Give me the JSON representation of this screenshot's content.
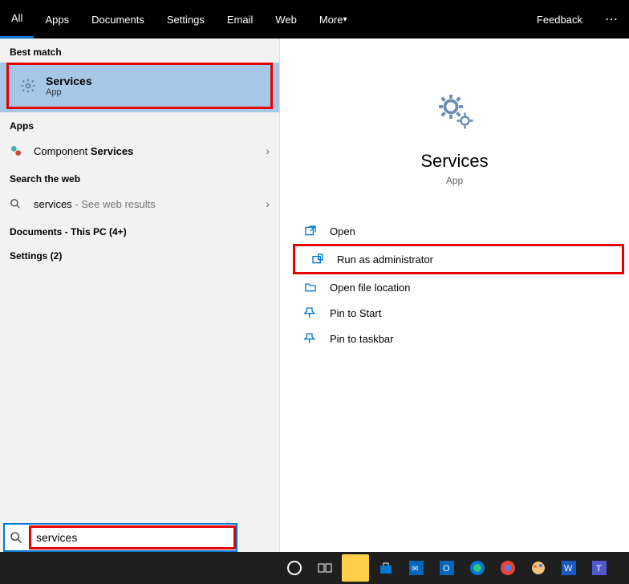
{
  "tabs": {
    "all": "All",
    "apps": "Apps",
    "documents": "Documents",
    "settings": "Settings",
    "email": "Email",
    "web": "Web",
    "more": "More",
    "feedback": "Feedback"
  },
  "left": {
    "bestMatchHeader": "Best match",
    "bestResult": {
      "title": "Services",
      "subtitle": "App"
    },
    "appsHeader": "Apps",
    "componentServicesPrefix": "Component ",
    "componentServicesBold": "Services",
    "searchWebHeader": "Search the web",
    "webPrefix": "services",
    "webSuffix": " - See web results",
    "documentsHeader": "Documents - This PC (4+)",
    "settingsHeader": "Settings (2)"
  },
  "right": {
    "title": "Services",
    "subtitle": "App",
    "actions": {
      "open": "Open",
      "runAdmin": "Run as administrator",
      "openLocation": "Open file location",
      "pinStart": "Pin to Start",
      "pinTaskbar": "Pin to taskbar"
    }
  },
  "search": {
    "value": "services"
  }
}
